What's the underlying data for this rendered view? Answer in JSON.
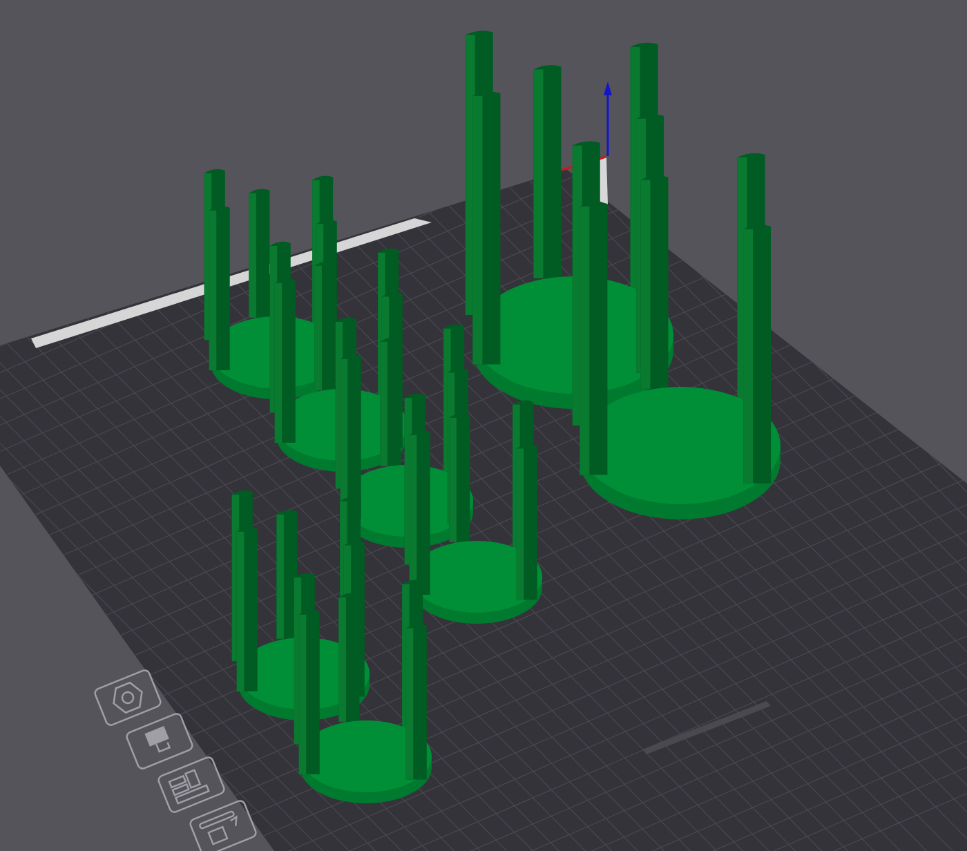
{
  "viewport": {
    "objects": [
      {
        "kind": "small"
      },
      {
        "kind": "small"
      },
      {
        "kind": "small"
      },
      {
        "kind": "small"
      },
      {
        "kind": "small"
      },
      {
        "kind": "small"
      },
      {
        "kind": "large"
      },
      {
        "kind": "large"
      }
    ],
    "plate_buttons": [
      {
        "kind": "nut"
      },
      {
        "kind": "filament"
      },
      {
        "kind": "layout"
      },
      {
        "kind": "auto"
      }
    ]
  }
}
